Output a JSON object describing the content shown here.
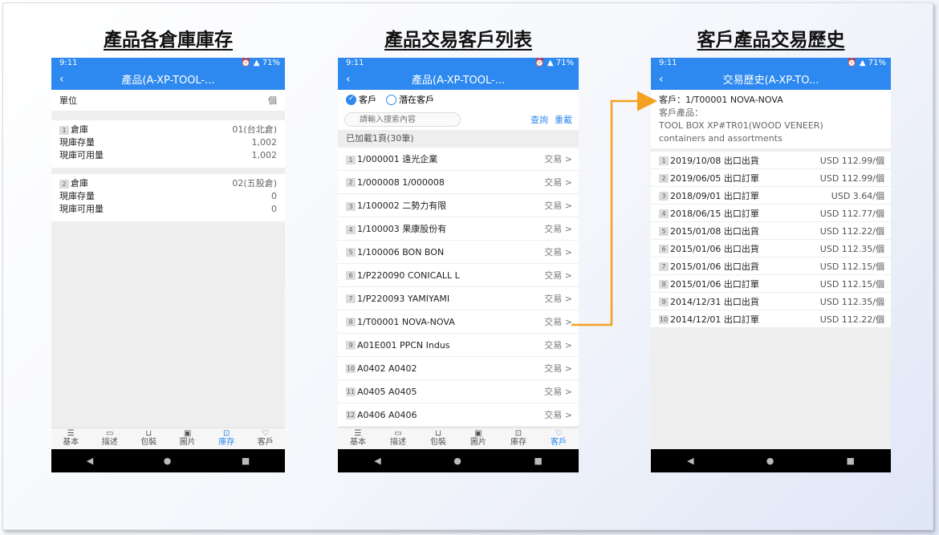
{
  "headings": {
    "inventory": "產品各倉庫庫存",
    "customers": "產品交易客戶列表",
    "history": "客戶產品交易歷史"
  },
  "status": {
    "time": "9:11",
    "battery": "71%"
  },
  "phone1": {
    "title": "產品(A-XP-TOOL-...",
    "unit_label": "單位",
    "unit_value": "個",
    "warehouses": [
      {
        "idx": "1",
        "label": "倉庫",
        "value": "01(台北倉)",
        "stock_label": "現庫存量",
        "stock": "1,002",
        "avail_label": "現庫可用量",
        "avail": "1,002"
      },
      {
        "idx": "2",
        "label": "倉庫",
        "value": "02(五股倉)",
        "stock_label": "現庫存量",
        "stock": "0",
        "avail_label": "現庫可用量",
        "avail": "0"
      }
    ]
  },
  "phone2": {
    "title": "產品(A-XP-TOOL-...",
    "radio_customer": "客戶",
    "radio_prospect": "潛在客戶",
    "search_placeholder": "請輸入搜索內容",
    "query": "查詢",
    "reload": "重載",
    "loaded": "已加載1頁(30筆)",
    "action_label": "交易 >",
    "customers": [
      {
        "idx": "1",
        "name": "1/000001 遠光企業"
      },
      {
        "idx": "2",
        "name": "1/000008 1/000008"
      },
      {
        "idx": "3",
        "name": "1/100002 二勢力有限"
      },
      {
        "idx": "4",
        "name": "1/100003 果康股份有"
      },
      {
        "idx": "5",
        "name": "1/100006 BON BON"
      },
      {
        "idx": "6",
        "name": "1/P220090 CONICALL L"
      },
      {
        "idx": "7",
        "name": "1/P220093 YAMIYAMI"
      },
      {
        "idx": "8",
        "name": "1/T00001 NOVA-NOVA"
      },
      {
        "idx": "9",
        "name": "A01E001 PPCN Indus"
      },
      {
        "idx": "10",
        "name": "A0402 A0402"
      },
      {
        "idx": "11",
        "name": "A0405 A0405"
      },
      {
        "idx": "12",
        "name": "A0406 A0406"
      }
    ]
  },
  "phone3": {
    "title": "交易歷史(A-XP-TO...",
    "customer_line": "客戶：1/T00001 NOVA-NOVA",
    "product_label": "客戶產品：",
    "product_name": "TOOL BOX XP#TR01(WOOD VENEER)",
    "product_desc": "containers and assortments",
    "history": [
      {
        "idx": "1",
        "date": "2019/10/08 出口出貨",
        "amount": "USD 112.99/個"
      },
      {
        "idx": "2",
        "date": "2019/06/05 出口訂單",
        "amount": "USD 112.99/個"
      },
      {
        "idx": "3",
        "date": "2018/09/01 出口訂單",
        "amount": "USD 3.64/個"
      },
      {
        "idx": "4",
        "date": "2018/06/15 出口訂單",
        "amount": "USD 112.77/個"
      },
      {
        "idx": "5",
        "date": "2015/01/08 出口出貨",
        "amount": "USD 112.22/個"
      },
      {
        "idx": "6",
        "date": "2015/01/06 出口出貨",
        "amount": "USD 112.35/個"
      },
      {
        "idx": "7",
        "date": "2015/01/06 出口出貨",
        "amount": "USD 112.15/個"
      },
      {
        "idx": "8",
        "date": "2015/01/06 出口訂單",
        "amount": "USD 112.15/個"
      },
      {
        "idx": "9",
        "date": "2014/12/31 出口出貨",
        "amount": "USD 112.35/個"
      },
      {
        "idx": "10",
        "date": "2014/12/01 出口訂單",
        "amount": "USD 112.22/個"
      }
    ]
  },
  "nav": {
    "basic": "基本",
    "describe": "描述",
    "package": "包裝",
    "image": "圖片",
    "inventory": "庫存",
    "customer": "客戶"
  },
  "colors": {
    "primary": "#2d89ef",
    "arrow": "#f5a020"
  }
}
